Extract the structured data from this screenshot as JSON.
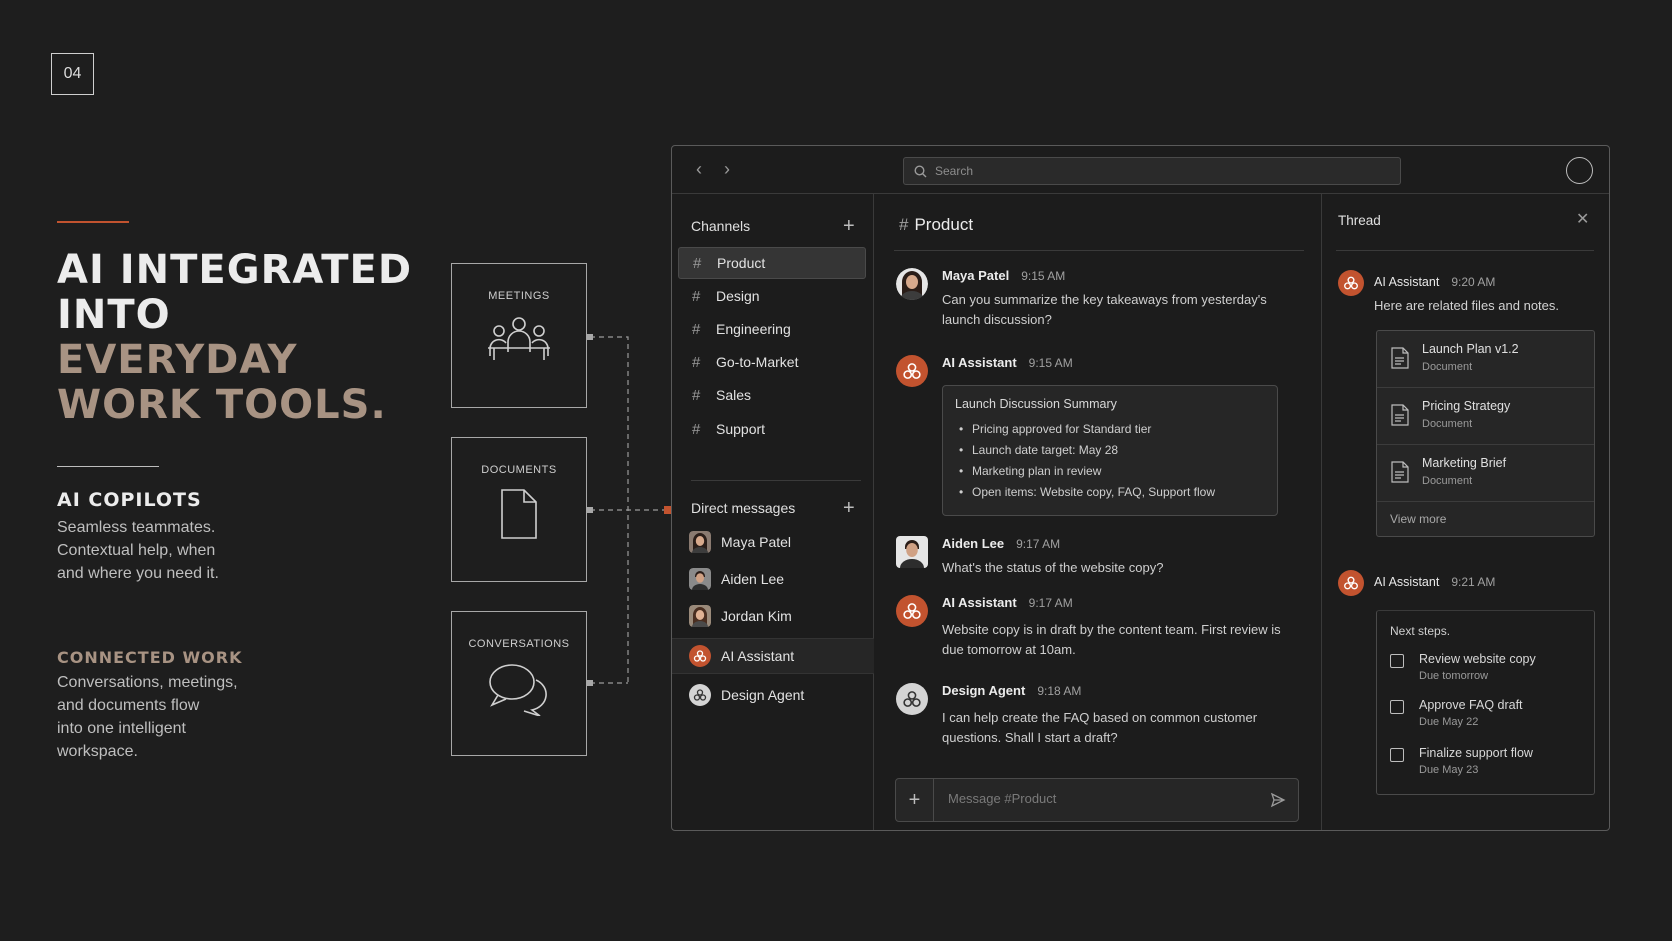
{
  "slide": {
    "number": "04"
  },
  "hero": {
    "title_line1": "AI INTEGRATED",
    "title_line2": "INTO",
    "title_line3": "EVERYDAY",
    "title_line4": "WORK TOOLS.",
    "copilots_title": "AI COPILOTS",
    "copilots_line1": "Seamless teammates.",
    "copilots_line2": "Contextual help, when",
    "copilots_line3": "and where you need it.",
    "connected_title": "CONNECTED WORK",
    "connected_line1": "Conversations, meetings,",
    "connected_line2": "and documents flow",
    "connected_line3": "into one intelligent",
    "connected_line4": "workspace."
  },
  "sources": [
    {
      "label": "MEETINGS",
      "icon": "people-icon"
    },
    {
      "label": "DOCUMENTS",
      "icon": "document-icon"
    },
    {
      "label": "CONVERSATIONS",
      "icon": "chat-bubbles-icon"
    }
  ],
  "colors": {
    "accent": "#c2532f",
    "muted_title": "#a89383",
    "background": "#1e1e1e"
  },
  "window": {
    "search_placeholder": "Search",
    "sidebar": {
      "channels_label": "Channels",
      "channels": [
        "Product",
        "Design",
        "Engineering",
        "Go-to-Market",
        "Sales",
        "Support"
      ],
      "active_channel": "Product",
      "dm_label": "Direct messages",
      "dms": [
        {
          "name": "Maya Patel",
          "avatar": "woman-photo"
        },
        {
          "name": "Aiden Lee",
          "avatar": "man-photo"
        },
        {
          "name": "Jordan Kim",
          "avatar": "woman-photo"
        },
        {
          "name": "AI Assistant",
          "avatar": "ai-assistant-icon"
        },
        {
          "name": "Design Agent",
          "avatar": "design-agent-icon"
        }
      ]
    },
    "main": {
      "channel_hash": "#",
      "channel_name": "Product",
      "messages": [
        {
          "name": "Maya Patel",
          "time": "9:15 AM",
          "text": "Can you summarize the key takeaways from yesterday's launch discussion?"
        },
        {
          "name": "AI Assistant",
          "time": "9:15 AM"
        },
        {
          "name": "Aiden Lee",
          "time": "9:17 AM",
          "text": "What's the status of the website copy?"
        },
        {
          "name": "AI Assistant",
          "time": "9:17 AM",
          "text": "Website copy is in draft by the content team. First review is due tomorrow at 10am."
        },
        {
          "name": "Design Agent",
          "time": "9:18 AM",
          "text": "I can help create the FAQ based on common customer questions. Shall I start a draft?"
        }
      ],
      "summary": {
        "title": "Launch Discussion Summary",
        "items": [
          "Pricing approved for Standard tier",
          "Launch date target: May 28",
          "Marketing plan in review",
          "Open items: Website copy, FAQ, Support flow"
        ]
      },
      "composer_placeholder": "Message #Product"
    },
    "thread": {
      "title": "Thread",
      "msg1": {
        "name": "AI Assistant",
        "time": "9:20 AM",
        "text": "Here are related files and notes."
      },
      "files": [
        {
          "name": "Launch Plan v1.2",
          "type": "Document"
        },
        {
          "name": "Pricing Strategy",
          "type": "Document"
        },
        {
          "name": "Marketing Brief",
          "type": "Document"
        }
      ],
      "view_more": "View more",
      "msg2": {
        "name": "AI Assistant",
        "time": "9:21 AM"
      },
      "steps_title": "Next steps.",
      "steps": [
        {
          "label": "Review website copy",
          "due": "Due tomorrow"
        },
        {
          "label": "Approve FAQ draft",
          "due": "Due May 22"
        },
        {
          "label": "Finalize support flow",
          "due": "Due May 23"
        }
      ]
    }
  }
}
